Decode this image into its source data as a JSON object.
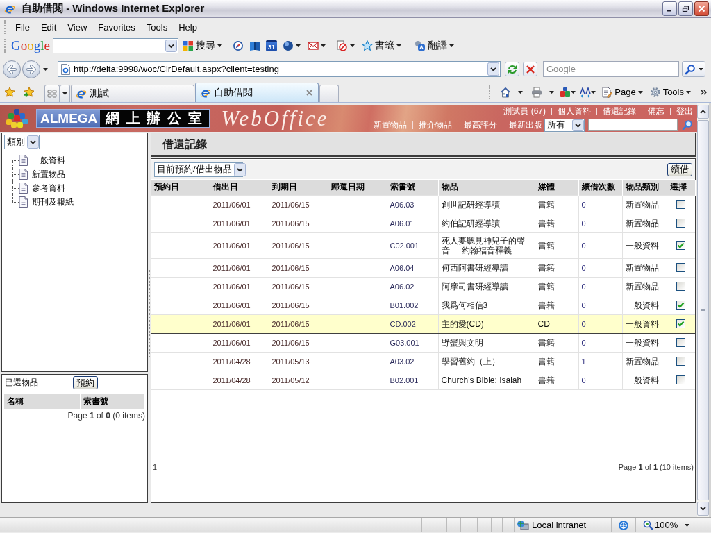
{
  "window": {
    "title": "自助借閱 - Windows Internet Explorer"
  },
  "menu_bar": [
    "File",
    "Edit",
    "View",
    "Favorites",
    "Tools",
    "Help"
  ],
  "google_toolbar": {
    "logo": "Google",
    "search_button": "搜尋",
    "calendar_day": "31",
    "bookmarks_button": "書籤",
    "translate_button": "翻譯"
  },
  "address_bar": {
    "url": "http://delta:9998/woc/CirDefault.aspx?client=testing",
    "search_placeholder": "Google"
  },
  "tabs": [
    {
      "label": "測試",
      "selected": false
    },
    {
      "label": "自助借閱",
      "selected": true
    }
  ],
  "command_bar": {
    "page_button": "Page",
    "tools_button": "Tools"
  },
  "header": {
    "brand": "ALMEGA",
    "brand_chinese": "網 上 辦 公 室",
    "product": "WebOffice",
    "user_links": [
      "測試員 (67)",
      "個人資料",
      "借還記錄",
      "備忘",
      "登出"
    ],
    "nav_links": [
      "新置物品",
      "推介物品",
      "最高評分",
      "最新出版"
    ],
    "scope_select": "所有"
  },
  "sidebar": {
    "category_select": "類別",
    "items": [
      {
        "label": "一般資料"
      },
      {
        "label": "新置物品"
      },
      {
        "label": "參考資料"
      },
      {
        "label": "期刊及報紙"
      }
    ]
  },
  "selected_items": {
    "title": "已選物品",
    "reserve_button": "預約",
    "columns": [
      "名稱",
      "索書號"
    ],
    "pager": "Page **1** of **0** (0 items)"
  },
  "panel_title": "借還記錄",
  "loans": {
    "filter_select": "目前預約/借出物品",
    "renew_button": "續借",
    "columns": [
      "預約日",
      "借出日",
      "到期日",
      "歸還日期",
      "索書號",
      "物品",
      "媒體",
      "續借次數",
      "物品類別",
      "選擇"
    ],
    "rows": [
      {
        "borrowed": "2011/06/01",
        "due": "2011/06/15",
        "call_number": "A06.03",
        "item": "創世記研經導讀",
        "media": "書籍",
        "renewals": "0",
        "category": "新置物品",
        "checked": false,
        "selected": false
      },
      {
        "borrowed": "2011/06/01",
        "due": "2011/06/15",
        "call_number": "A06.01",
        "item": "約伯記研經導讀",
        "media": "書籍",
        "renewals": "0",
        "category": "新置物品",
        "checked": false,
        "selected": false
      },
      {
        "borrowed": "2011/06/01",
        "due": "2011/06/15",
        "call_number": "C02.001",
        "item": "死人要聽見神兒子的聲音──約翰福音釋義",
        "media": "書籍",
        "renewals": "0",
        "category": "一般資料",
        "checked": true,
        "selected": false
      },
      {
        "borrowed": "2011/06/01",
        "due": "2011/06/15",
        "call_number": "A06.04",
        "item": "何西阿書研經導讀",
        "media": "書籍",
        "renewals": "0",
        "category": "新置物品",
        "checked": false,
        "selected": false
      },
      {
        "borrowed": "2011/06/01",
        "due": "2011/06/15",
        "call_number": "A06.02",
        "item": "阿摩司書研經導讀",
        "media": "書籍",
        "renewals": "0",
        "category": "新置物品",
        "checked": false,
        "selected": false
      },
      {
        "borrowed": "2011/06/01",
        "due": "2011/06/15",
        "call_number": "B01.002",
        "item": "我爲何相信3",
        "media": "書籍",
        "renewals": "0",
        "category": "一般資料",
        "checked": true,
        "selected": false
      },
      {
        "borrowed": "2011/06/01",
        "due": "2011/06/15",
        "call_number": "CD.002",
        "item": "主的愛(CD)",
        "media": "CD",
        "renewals": "0",
        "category": "一般資料",
        "checked": true,
        "selected": true
      },
      {
        "borrowed": "2011/06/01",
        "due": "2011/06/15",
        "call_number": "G03.001",
        "item": "野蠻與文明",
        "media": "書籍",
        "renewals": "0",
        "category": "一般資料",
        "checked": false,
        "selected": false
      },
      {
        "borrowed": "2011/04/28",
        "due": "2011/05/13",
        "call_number": "A03.02",
        "item": "學習舊約（上）",
        "media": "書籍",
        "renewals": "1",
        "category": "新置物品",
        "checked": false,
        "selected": false
      },
      {
        "borrowed": "2011/04/28",
        "due": "2011/05/12",
        "call_number": "B02.001",
        "item": "Church's Bible: Isaiah",
        "media": "書籍",
        "renewals": "0",
        "category": "一般資料",
        "checked": false,
        "selected": false
      }
    ],
    "page_number": "1",
    "pager": "Page **1** of **1** (10 items)"
  },
  "status_bar": {
    "zone": "Local intranet",
    "zoom": "100%"
  }
}
